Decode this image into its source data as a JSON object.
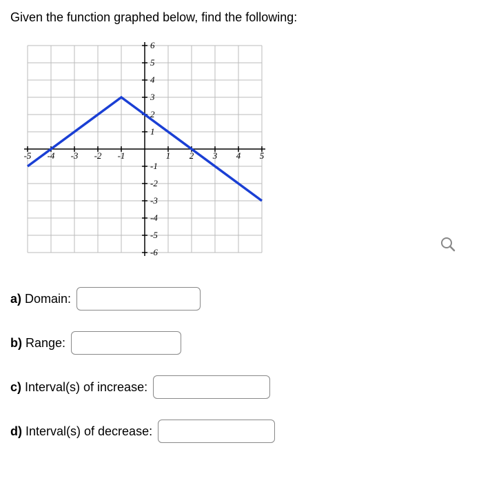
{
  "prompt": "Given the function graphed below, find the following:",
  "chart_data": {
    "type": "line",
    "title": "",
    "xlabel": "",
    "ylabel": "",
    "xlim": [
      -5,
      5
    ],
    "ylim": [
      -6,
      6
    ],
    "x": [
      -5,
      -1,
      5
    ],
    "y": [
      -1,
      3,
      -3
    ],
    "x_ticks": [
      -5,
      -4,
      -3,
      -2,
      -1,
      1,
      2,
      3,
      4,
      5
    ],
    "y_ticks": [
      -6,
      -5,
      -4,
      -3,
      -2,
      -1,
      1,
      2,
      3,
      4,
      5,
      6
    ],
    "grid": true,
    "line_color": "#1a3fd4"
  },
  "questions": {
    "a": {
      "label_bold": "a)",
      "label_text": " Domain: "
    },
    "b": {
      "label_bold": "b)",
      "label_text": " Range: "
    },
    "c": {
      "label_bold": "c)",
      "label_text": " Interval(s) of increase: "
    },
    "d": {
      "label_bold": "d)",
      "label_text": " Interval(s) of decrease: "
    }
  }
}
